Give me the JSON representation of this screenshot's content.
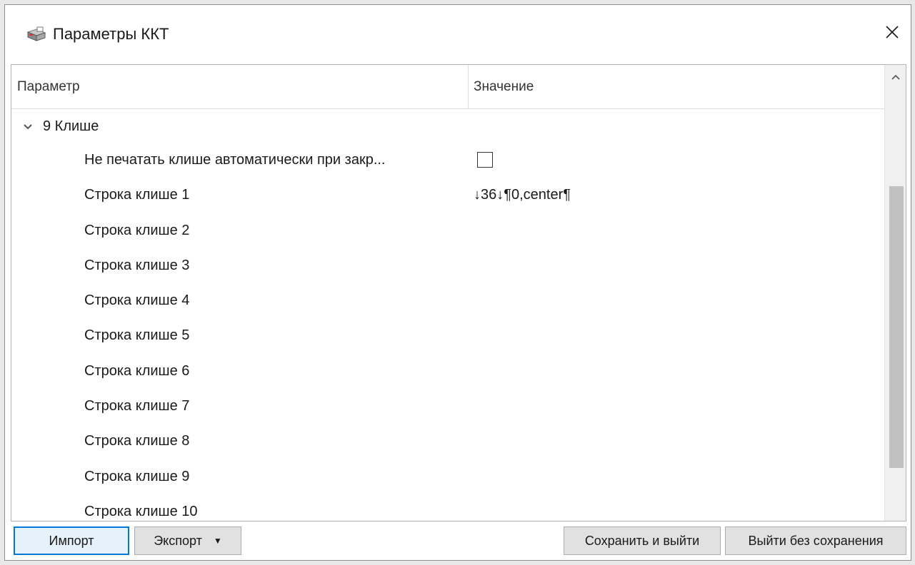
{
  "window": {
    "title": "Параметры ККТ",
    "icon": "printer-icon",
    "close_glyph": "✕"
  },
  "grid": {
    "headers": {
      "parameter": "Параметр",
      "value": "Значение"
    },
    "group": {
      "label": "9 Клише",
      "expanded": true
    },
    "rows": [
      {
        "label": "Не печатать клише автоматически при закр...",
        "type": "checkbox",
        "checked": false
      },
      {
        "label": "Строка клише 1",
        "value": "↓36↓¶0,center¶"
      },
      {
        "label": "Строка клише 2",
        "value": ""
      },
      {
        "label": "Строка клише 3",
        "value": ""
      },
      {
        "label": "Строка клише 4",
        "value": ""
      },
      {
        "label": "Строка клише 5",
        "value": ""
      },
      {
        "label": "Строка клише 6",
        "value": ""
      },
      {
        "label": "Строка клише 7",
        "value": ""
      },
      {
        "label": "Строка клише 8",
        "value": ""
      },
      {
        "label": "Строка клише 9",
        "value": ""
      },
      {
        "label": "Строка клише 10",
        "value": ""
      }
    ]
  },
  "buttons": {
    "import": "Импорт",
    "export": "Экспорт",
    "export_arrow": "▼",
    "save_exit": "Сохранить и выйти",
    "exit_no_save": "Выйти без сохранения"
  },
  "colors": {
    "accent": "#0078d7",
    "button_bg": "#e1e1e1",
    "scroll_thumb": "#c1c1c1"
  }
}
